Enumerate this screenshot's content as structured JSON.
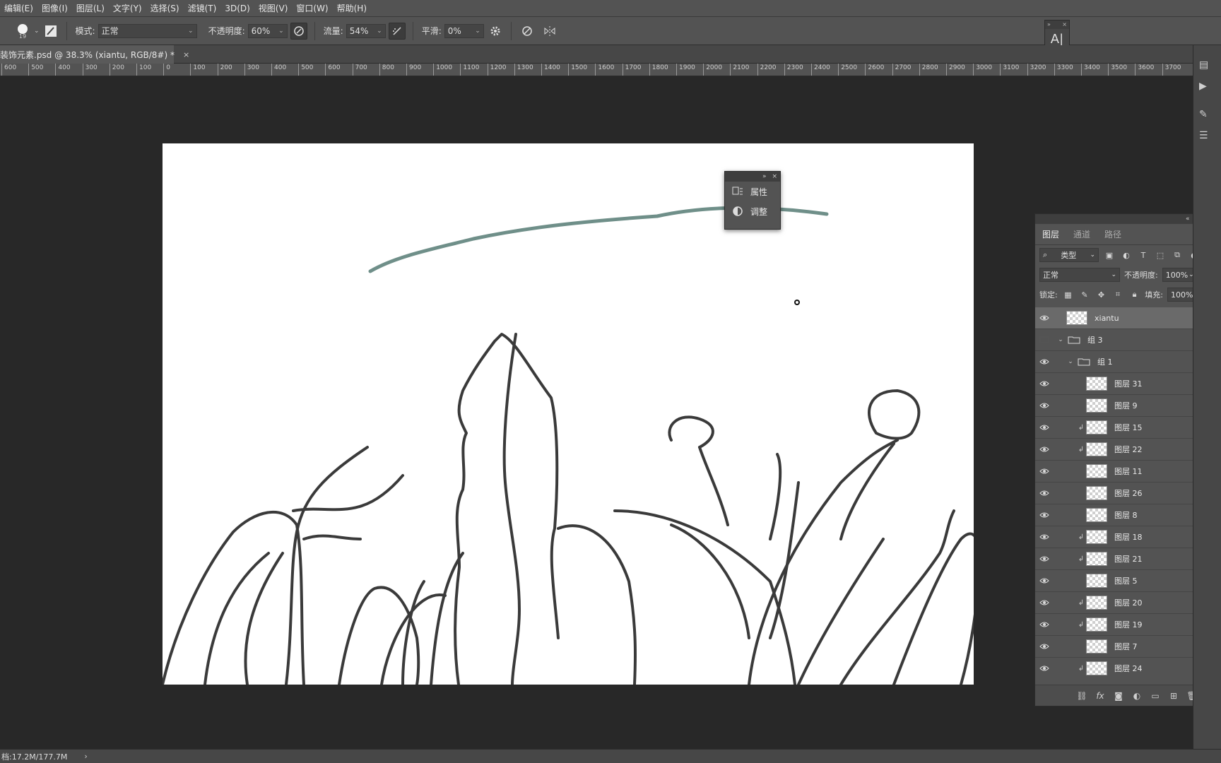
{
  "menu": [
    "编辑(E)",
    "图像(I)",
    "图层(L)",
    "文字(Y)",
    "选择(S)",
    "滤镜(T)",
    "3D(D)",
    "视图(V)",
    "窗口(W)",
    "帮助(H)"
  ],
  "options": {
    "brush_size": "19",
    "mode_label": "模式:",
    "mode_value": "正常",
    "opacity_label": "不透明度:",
    "opacity_value": "60%",
    "flow_label": "流量:",
    "flow_value": "54%",
    "smoothing_label": "平滑:",
    "smoothing_value": "0%"
  },
  "document_tab": {
    "title": "装饰元素.psd @ 38.3% (xiantu, RGB/8#) *",
    "close": "×"
  },
  "ruler": {
    "ticks": [
      "600",
      "500",
      "400",
      "300",
      "200",
      "100",
      "0",
      "100",
      "200",
      "300",
      "400",
      "500",
      "600",
      "700",
      "800",
      "900",
      "1000",
      "1100",
      "1200",
      "1300",
      "1400",
      "1500",
      "1600",
      "1700",
      "1800",
      "1900",
      "2000",
      "2100",
      "2200",
      "2300",
      "2400",
      "2500",
      "2600",
      "2700",
      "2800",
      "2900",
      "3000",
      "3100",
      "3200",
      "3300",
      "3400",
      "3500",
      "3600",
      "3700"
    ]
  },
  "status": {
    "doc_size": "档:17.2M/177.7M",
    "arrow": "›"
  },
  "props_panel": {
    "items": [
      "属性",
      "调整"
    ]
  },
  "layers_panel": {
    "tabs": [
      "图层",
      "通道",
      "路径"
    ],
    "filter_kind": "类型",
    "blend_mode": "正常",
    "opacity_label": "不透明度:",
    "opacity_value": "100%",
    "lock_label": "锁定:",
    "fill_label": "填充:",
    "fill_value": "100%",
    "layers": [
      {
        "name": "xiantu",
        "type": "layer",
        "indent": 0,
        "visible": true,
        "selected": true,
        "clipped": false
      },
      {
        "name": "组 3",
        "type": "group",
        "indent": 0,
        "visible": false,
        "selected": false,
        "clipped": false
      },
      {
        "name": "组 1",
        "type": "group",
        "indent": 1,
        "visible": true,
        "selected": false,
        "clipped": false
      },
      {
        "name": "图层 31",
        "type": "layer",
        "indent": 2,
        "visible": true,
        "selected": false,
        "clipped": false
      },
      {
        "name": "图层 9",
        "type": "layer",
        "indent": 2,
        "visible": true,
        "selected": false,
        "clipped": false
      },
      {
        "name": "图层 15",
        "type": "layer",
        "indent": 2,
        "visible": true,
        "selected": false,
        "clipped": true
      },
      {
        "name": "图层 22",
        "type": "layer",
        "indent": 2,
        "visible": true,
        "selected": false,
        "clipped": true
      },
      {
        "name": "图层 11",
        "type": "layer",
        "indent": 2,
        "visible": true,
        "selected": false,
        "clipped": false
      },
      {
        "name": "图层 26",
        "type": "layer",
        "indent": 2,
        "visible": true,
        "selected": false,
        "clipped": false
      },
      {
        "name": "图层 8",
        "type": "layer",
        "indent": 2,
        "visible": true,
        "selected": false,
        "clipped": false
      },
      {
        "name": "图层 18",
        "type": "layer",
        "indent": 2,
        "visible": true,
        "selected": false,
        "clipped": true
      },
      {
        "name": "图层 21",
        "type": "layer",
        "indent": 2,
        "visible": true,
        "selected": false,
        "clipped": true
      },
      {
        "name": "图层 5",
        "type": "layer",
        "indent": 2,
        "visible": true,
        "selected": false,
        "clipped": false
      },
      {
        "name": "图层 20",
        "type": "layer",
        "indent": 2,
        "visible": true,
        "selected": false,
        "clipped": true
      },
      {
        "name": "图层 19",
        "type": "layer",
        "indent": 2,
        "visible": true,
        "selected": false,
        "clipped": true
      },
      {
        "name": "图层 7",
        "type": "layer",
        "indent": 2,
        "visible": true,
        "selected": false,
        "clipped": false
      },
      {
        "name": "图层 24",
        "type": "layer",
        "indent": 2,
        "visible": true,
        "selected": false,
        "clipped": true
      }
    ]
  },
  "colors": {
    "stroke_teal": "#6f8f89",
    "lineart": "#3a3a3a",
    "canvas": "#ffffff",
    "workspace": "#282828",
    "panel": "#535353"
  },
  "icons": [
    "brush-icon",
    "brush-panel-icon",
    "pressure-opacity-icon",
    "airbrush-icon",
    "settings-gear-icon",
    "pressure-size-icon",
    "symmetry-icon",
    "eye-icon",
    "folder-icon",
    "clip-arrow-icon",
    "link-icon",
    "fx-icon",
    "mask-icon",
    "adjustment-icon",
    "new-group-icon",
    "new-layer-icon",
    "trash-icon"
  ]
}
